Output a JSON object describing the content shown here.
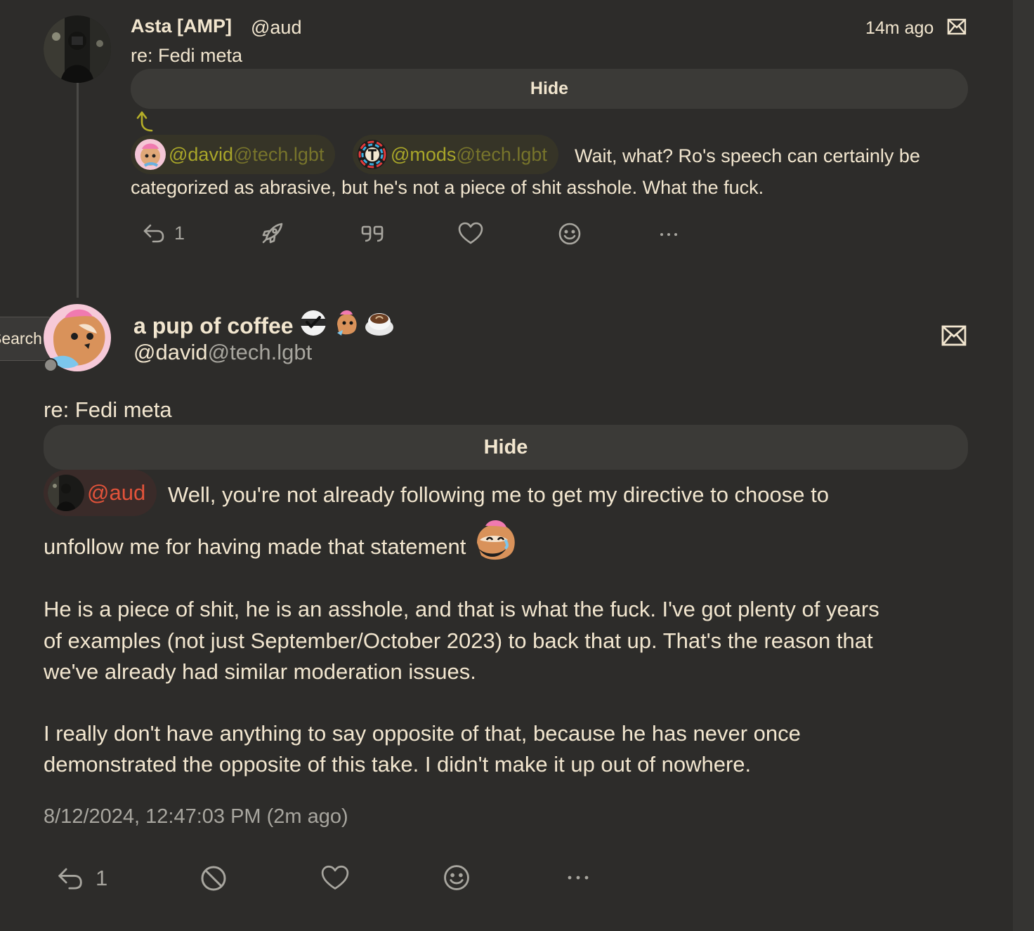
{
  "post1": {
    "display_name": "Asta [AMP]",
    "handle": "@aud",
    "time": "14m ago",
    "content_warning": "re: Fedi meta",
    "hide_label": "Hide",
    "mentions": [
      {
        "user": "@david",
        "host": "@tech.lgbt"
      },
      {
        "user": "@mods",
        "host": "@tech.lgbt"
      }
    ],
    "text_line1": "Wait, what?  Ro's speech can certainly be",
    "text_line2": "categorized as abrasive, but he's not a piece of shit asshole.  What the fuck.",
    "reply_count": "1",
    "icons": [
      "reply-icon",
      "boost-icon",
      "quote-icon",
      "favourite-icon",
      "emoji-react-icon",
      "more-icon",
      "mail-icon"
    ]
  },
  "tooltip": {
    "label": "Search"
  },
  "post2": {
    "display_name": "a pup of coffee",
    "handle_user": "@david",
    "handle_host": "@tech.lgbt",
    "content_warning": "re: Fedi meta",
    "hide_label": "Hide",
    "mention": "@aud",
    "body_lines": [
      "Well, you're not already following me to get my directive to choose to",
      "unfollow me for having made that statement",
      "He is a piece of shit, he is an asshole, and that is what the fuck. I've got plenty of years",
      "of examples (not just September/October 2023) to back that up. That's the reason that",
      "we've already had similar moderation issues.",
      "I really don't have anything to say opposite of that, because he has never once",
      "demonstrated the opposite of this take. I didn't make it up out of nowhere."
    ],
    "timestamp": "8/12/2024, 12:47:03 PM (2m ago)",
    "reply_count": "1",
    "icons": [
      "reply-icon",
      "block-icon",
      "favourite-icon",
      "emoji-react-icon",
      "more-icon",
      "mail-icon"
    ]
  },
  "colors": {
    "background": "#2d2c2a",
    "text": "#f2e6cf",
    "muted": "#a8a69f",
    "mention_olive": "#a9a629",
    "mention_red": "#e2533a"
  }
}
